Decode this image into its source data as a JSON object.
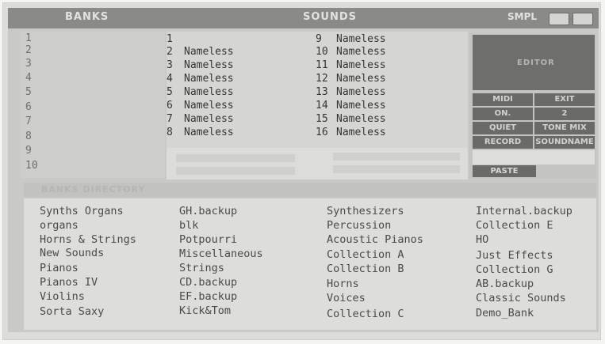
{
  "titlebar": {
    "banks_label": "BANKS",
    "sounds_label": "SOUNDS",
    "brand": "SMPL"
  },
  "banks": [
    "1",
    "2",
    "3",
    "4",
    "5",
    "6",
    "7",
    "8",
    "9",
    "10"
  ],
  "sounds": {
    "left_column": [
      {
        "num": "1",
        "name": ""
      },
      {
        "num": "2",
        "name": "Nameless"
      },
      {
        "num": "3",
        "name": "Nameless"
      },
      {
        "num": "4",
        "name": "Nameless"
      },
      {
        "num": "5",
        "name": "Nameless"
      },
      {
        "num": "6",
        "name": "Nameless"
      },
      {
        "num": "7",
        "name": "Nameless"
      },
      {
        "num": "8",
        "name": "Nameless"
      }
    ],
    "right_column": [
      {
        "num": "9",
        "name": "Nameless"
      },
      {
        "num": "10",
        "name": "Nameless"
      },
      {
        "num": "11",
        "name": "Nameless"
      },
      {
        "num": "12",
        "name": "Nameless"
      },
      {
        "num": "13",
        "name": "Nameless"
      },
      {
        "num": "14",
        "name": "Nameless"
      },
      {
        "num": "15",
        "name": "Nameless"
      },
      {
        "num": "16",
        "name": "Nameless"
      }
    ]
  },
  "editor": {
    "title": "EDITOR",
    "midi_label": "MIDI",
    "exit_label": "EXIT",
    "on_label": "ON.",
    "channel_value": "2",
    "quiet_label": "QUIET",
    "tone_mix_label": "TONE MIX",
    "record_label": "RECORD",
    "sound_name_label": "SOUNDNAME",
    "paste_label": "PASTE"
  },
  "directory_bar": {
    "label": "BANKS DIRECTORY"
  },
  "file_list": {
    "col1": [
      "Synths Organs",
      "organs",
      "Horns & Strings",
      "New Sounds",
      "Pianos",
      "Pianos IV",
      "Violins",
      "Sorta Saxy"
    ],
    "col2": [
      "GH.backup",
      "blk",
      "Potpourri",
      "Miscellaneous",
      "Strings",
      "CD.backup",
      "EF.backup",
      "Kick&Tom"
    ],
    "col3": [
      "Synthesizers",
      "Percussion",
      "Acoustic Pianos",
      "Collection A",
      "Collection B",
      "Horns",
      "Voices",
      "Collection C"
    ],
    "col4": [
      "Internal.backup",
      "Collection E",
      "HO",
      "Just Effects",
      "Collection G",
      "AB.backup",
      "Classic Sounds",
      "Demo_Bank"
    ]
  }
}
